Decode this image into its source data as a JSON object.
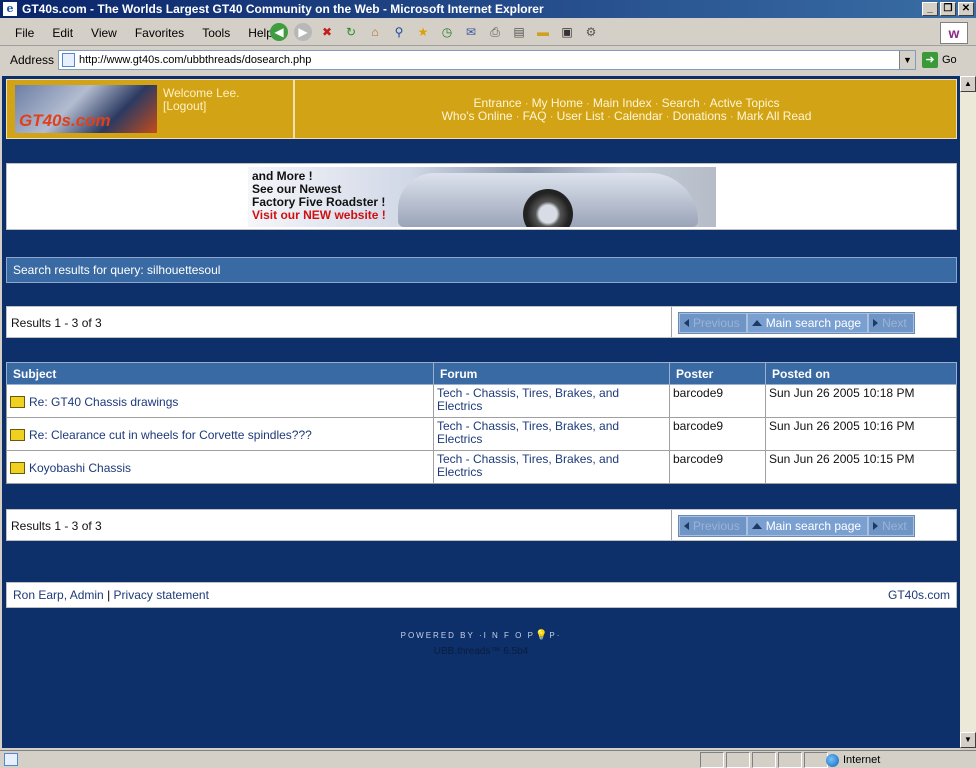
{
  "window": {
    "title": "GT40s.com - The Worlds Largest GT40 Community on the Web - Microsoft Internet Explorer",
    "buttons": [
      "_",
      "❐",
      "✕"
    ]
  },
  "menu": {
    "items": [
      "File",
      "Edit",
      "View",
      "Favorites",
      "Tools",
      "Help"
    ]
  },
  "toolbar": {
    "icons": [
      "back-icon",
      "forward-icon",
      "stop-icon",
      "refresh-icon",
      "home-icon",
      "search-icon",
      "favorites-icon",
      "history-icon",
      "mail-icon",
      "print-icon",
      "edit-icon",
      "discuss-icon",
      "media-icon",
      "research-icon"
    ]
  },
  "address": {
    "label": "Address",
    "url": "http://www.gt40s.com/ubbthreads/dosearch.php",
    "go_label": "Go"
  },
  "header": {
    "logo_text": "GT40s.com",
    "welcome": "Welcome Lee.",
    "logout": "[Logout]",
    "nav_row1": [
      "Entrance",
      "My Home",
      "Main Index",
      "Search",
      "Active Topics"
    ],
    "nav_row2": [
      "Who's Online",
      "FAQ",
      "User List",
      "Calendar",
      "Donations",
      "Mark All Read"
    ],
    "separator": "·"
  },
  "banner": {
    "line1": "and More !",
    "line2": "See our Newest",
    "line3": "Factory Five Roadster !",
    "line4": "Visit our NEW website !"
  },
  "search": {
    "query_label": "Search results for query: silhouettesoul"
  },
  "results_summary": "Results 1 - 3 of 3",
  "pager": {
    "previous": "Previous",
    "main": "Main search page",
    "next": "Next"
  },
  "table": {
    "headers": [
      "Subject",
      "Forum",
      "Poster",
      "Posted on"
    ],
    "rows": [
      {
        "subject": "Re: GT40 Chassis drawings",
        "forum": "Tech - Chassis, Tires, Brakes, and Electrics",
        "poster": "barcode9",
        "posted": "Sun Jun 26 2005 10:18 PM"
      },
      {
        "subject": "Re: Clearance cut in wheels for Corvette spindles???",
        "forum": "Tech - Chassis, Tires, Brakes, and Electrics",
        "poster": "barcode9",
        "posted": "Sun Jun 26 2005 10:16 PM"
      },
      {
        "subject": "Koyobashi Chassis",
        "forum": "Tech - Chassis, Tires, Brakes, and Electrics",
        "poster": "barcode9",
        "posted": "Sun Jun 26 2005 10:15 PM"
      }
    ]
  },
  "footer": {
    "admin": "Ron Earp, Admin",
    "divider": "|",
    "privacy": "Privacy statement",
    "site": "GT40s.com"
  },
  "powered": {
    "text": "POWERED BY",
    "brand_a": "·I N F O P",
    "brand_b": "P·",
    "version": "UBB.threads™ 6.5b4"
  },
  "status": {
    "zone": "Internet"
  }
}
